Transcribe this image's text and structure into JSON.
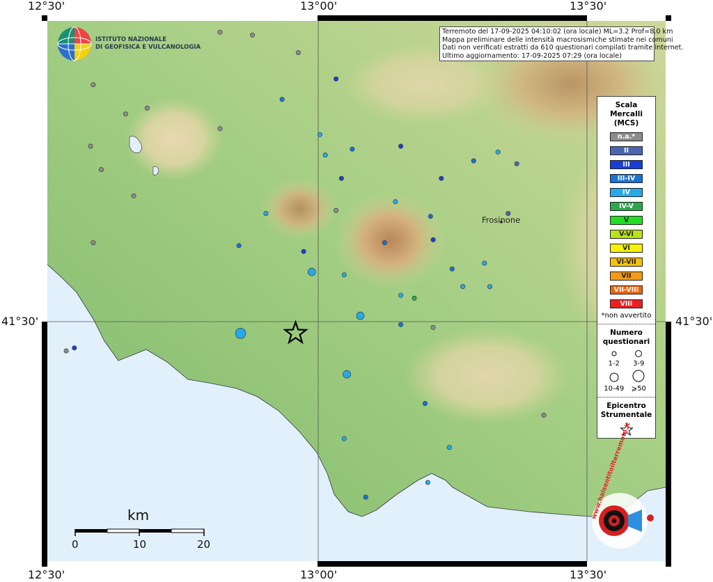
{
  "coords": {
    "top": [
      "12°30'",
      "13°00'",
      "13°30'"
    ],
    "bottom": [
      "12°30'",
      "13°00'",
      "13°30'"
    ],
    "left": "41°30'",
    "right": "41°30'"
  },
  "logo": {
    "line1": "ISTITUTO NAZIONALE",
    "line2": "DI GEOFISICA E VULCANOLOGIA"
  },
  "info": {
    "line1": "Terremoto del 17-09-2025 04:10:02 (ora locale) ML=3.2 Prof=8.0 km",
    "line2": "Mappa preliminare delle intensità macrosismiche stimate nei comuni",
    "line3": "Dati non verificati estratti da 610 questionari compilati tramite Internet.",
    "line4": "Ultimo aggiornamento: 17-09-2025 07:29 (ora locale)"
  },
  "city": "Frosinone",
  "legend": {
    "title1": "Scala",
    "title2": "Mercalli",
    "title3": "(MCS)",
    "classes": [
      {
        "label": "n.a.*",
        "color": "#8c8c8c"
      },
      {
        "label": "II",
        "color": "#4b65b0"
      },
      {
        "label": "III",
        "color": "#1a3fd6"
      },
      {
        "label": "III-IV",
        "color": "#1872d8"
      },
      {
        "label": "IV",
        "color": "#26a9e8"
      },
      {
        "label": "IV-V",
        "color": "#2aa84a"
      },
      {
        "label": "V",
        "color": "#22dd22"
      },
      {
        "label": "V-VI",
        "color": "#b8e21a"
      },
      {
        "label": "VI",
        "color": "#f5f20a"
      },
      {
        "label": "VI-VII",
        "color": "#f4c20e"
      },
      {
        "label": "VII",
        "color": "#f49a14"
      },
      {
        "label": "VII-VIII",
        "color": "#ea6412"
      },
      {
        "label": "VIII",
        "color": "#e82222"
      }
    ],
    "note": "*non avvertito",
    "count_title1": "Numero",
    "count_title2": "questionari",
    "counts": [
      "1-2",
      "3-9",
      "10-49",
      "⩾50"
    ],
    "epi_title1": "Epicentro",
    "epi_title2": "Strumentale"
  },
  "scale": {
    "unit": "km",
    "ticks": [
      "0",
      "10",
      "20"
    ]
  },
  "watermark": "www.haisentitoilterremoto.it",
  "points": [
    {
      "lon": 12.858,
      "lat": 41.48,
      "color": "#26a9e8",
      "n": 3
    },
    {
      "lon": 12.96,
      "lat": 41.48,
      "color": "star",
      "n": 0
    },
    {
      "lon": 13.08,
      "lat": 41.51,
      "color": "#26a9e8",
      "n": 2
    },
    {
      "lon": 13.055,
      "lat": 41.41,
      "color": "#26a9e8",
      "n": 2
    },
    {
      "lon": 12.99,
      "lat": 41.585,
      "color": "#26a9e8",
      "n": 2
    },
    {
      "lon": 13.05,
      "lat": 41.58,
      "color": "#26a9e8",
      "n": 1
    },
    {
      "lon": 12.975,
      "lat": 41.62,
      "color": "#1a3fd6",
      "n": 1
    },
    {
      "lon": 12.855,
      "lat": 41.63,
      "color": "#1872d8",
      "n": 1
    },
    {
      "lon": 12.905,
      "lat": 41.685,
      "color": "#26a9e8",
      "n": 1
    },
    {
      "lon": 13.015,
      "lat": 41.785,
      "color": "#26a9e8",
      "n": 1
    },
    {
      "lon": 13.045,
      "lat": 41.745,
      "color": "#1a3fd6",
      "n": 1
    },
    {
      "lon": 13.155,
      "lat": 41.8,
      "color": "#1a3fd6",
      "n": 1
    },
    {
      "lon": 13.23,
      "lat": 41.745,
      "color": "#1a3fd6",
      "n": 1
    },
    {
      "lon": 13.335,
      "lat": 41.79,
      "color": "#26a9e8",
      "n": 1
    },
    {
      "lon": 13.354,
      "lat": 41.685,
      "color": "#4b65b0",
      "n": 1
    },
    {
      "lon": 13.31,
      "lat": 41.6,
      "color": "#26a9e8",
      "n": 1
    },
    {
      "lon": 13.155,
      "lat": 41.545,
      "color": "#26a9e8",
      "n": 1
    },
    {
      "lon": 13.18,
      "lat": 41.54,
      "color": "#2aa84a",
      "n": 1
    },
    {
      "lon": 13.155,
      "lat": 41.495,
      "color": "#1872d8",
      "n": 1
    },
    {
      "lon": 12.55,
      "lat": 41.455,
      "color": "#1a3fd6",
      "n": 1
    },
    {
      "lon": 12.66,
      "lat": 41.715,
      "color": "#8c8c8c",
      "n": 1
    },
    {
      "lon": 12.585,
      "lat": 41.635,
      "color": "#8c8c8c",
      "n": 1
    },
    {
      "lon": 12.645,
      "lat": 41.855,
      "color": "#8c8c8c",
      "n": 1
    },
    {
      "lon": 12.685,
      "lat": 41.865,
      "color": "#8c8c8c",
      "n": 1
    },
    {
      "lon": 13.2,
      "lat": 41.36,
      "color": "#1872d8",
      "n": 1
    },
    {
      "lon": 13.245,
      "lat": 41.285,
      "color": "#26a9e8",
      "n": 1
    },
    {
      "lon": 13.25,
      "lat": 41.59,
      "color": "#1872d8",
      "n": 1
    },
    {
      "lon": 13.27,
      "lat": 41.56,
      "color": "#26a9e8",
      "n": 1
    },
    {
      "lon": 13.215,
      "lat": 41.64,
      "color": "#1a3fd6",
      "n": 1
    },
    {
      "lon": 13.125,
      "lat": 41.635,
      "color": "#1872d8",
      "n": 1
    },
    {
      "lon": 13.21,
      "lat": 41.68,
      "color": "#1872d8",
      "n": 1
    },
    {
      "lon": 13.145,
      "lat": 41.705,
      "color": "#26a9e8",
      "n": 1
    },
    {
      "lon": 13.035,
      "lat": 41.69,
      "color": "#8c8c8c",
      "n": 1
    },
    {
      "lon": 13.065,
      "lat": 41.795,
      "color": "#1872d8",
      "n": 1
    },
    {
      "lon": 13.005,
      "lat": 41.82,
      "color": "#26a9e8",
      "n": 1
    },
    {
      "lon": 12.82,
      "lat": 41.83,
      "color": "#8c8c8c",
      "n": 1
    },
    {
      "lon": 12.935,
      "lat": 41.88,
      "color": "#1872d8",
      "n": 1
    },
    {
      "lon": 13.035,
      "lat": 41.915,
      "color": "#1a3fd6",
      "n": 1
    },
    {
      "lon": 12.965,
      "lat": 41.96,
      "color": "#8c8c8c",
      "n": 1
    },
    {
      "lon": 12.985,
      "lat": 42.02,
      "color": "#1a3fd6",
      "n": 1
    },
    {
      "lon": 12.82,
      "lat": 41.995,
      "color": "#8c8c8c",
      "n": 1
    },
    {
      "lon": 12.88,
      "lat": 41.99,
      "color": "#8c8c8c",
      "n": 1
    },
    {
      "lon": 12.585,
      "lat": 41.905,
      "color": "#8c8c8c",
      "n": 1
    },
    {
      "lon": 12.58,
      "lat": 41.8,
      "color": "#8c8c8c",
      "n": 1
    },
    {
      "lon": 12.6,
      "lat": 41.76,
      "color": "#8c8c8c",
      "n": 1
    },
    {
      "lon": 12.535,
      "lat": 41.45,
      "color": "#8c8c8c",
      "n": 1
    },
    {
      "lon": 13.205,
      "lat": 41.225,
      "color": "#26a9e8",
      "n": 1
    },
    {
      "lon": 13.05,
      "lat": 41.3,
      "color": "#26a9e8",
      "n": 1
    },
    {
      "lon": 13.09,
      "lat": 41.2,
      "color": "#1872d8",
      "n": 1
    },
    {
      "lon": 13.42,
      "lat": 41.34,
      "color": "#8c8c8c",
      "n": 1
    },
    {
      "lon": 13.37,
      "lat": 41.77,
      "color": "#4b65b0",
      "n": 1
    },
    {
      "lon": 13.32,
      "lat": 41.56,
      "color": "#26a9e8",
      "n": 1
    },
    {
      "lon": 13.29,
      "lat": 41.775,
      "color": "#1872d8",
      "n": 1
    },
    {
      "lon": 13.215,
      "lat": 41.49,
      "color": "#8c8c8c",
      "n": 1
    }
  ]
}
